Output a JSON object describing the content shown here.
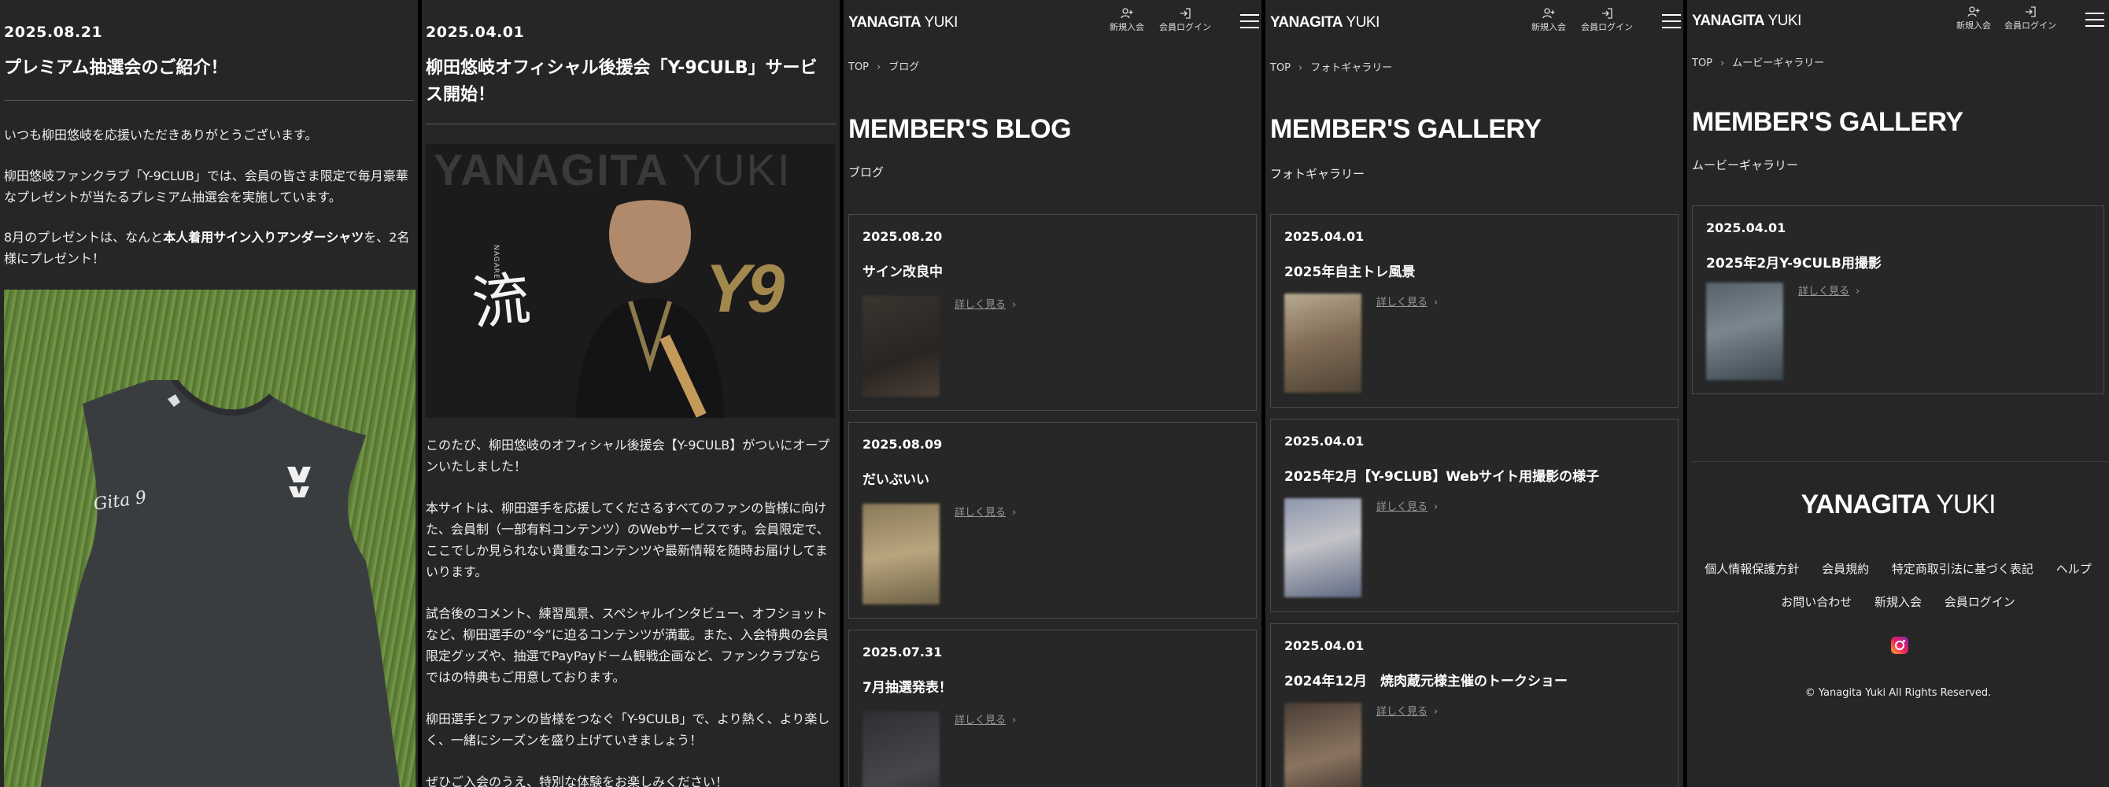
{
  "panel1": {
    "date": "2025.08.21",
    "title": "プレミアム抽選会のご紹介！",
    "p1": "いつも柳田悠岐を応援いただきありがとうございます。",
    "p2": "柳田悠岐ファンクラブ「Y-9CLUB」では、会員の皆さま限定で毎月豪華なプレゼントが当たるプレミアム抽選会を実施しています。",
    "p3_pre": "8月のプレゼントは、なんと",
    "p3_bold": "本人着用サイン入りアンダーシャツ",
    "p3_post": "を、2名様にプレゼント！",
    "photo": {
      "shirt_text": "Gita 9"
    }
  },
  "panel2": {
    "date": "2025.04.01",
    "title": "柳田悠岐オフィシャル後援会「Y-9CULB」サービス開始！",
    "hero": {
      "bg_bold": "YANAGITA",
      "bg_light": " YUKI",
      "kanji": "流",
      "small": "NAGARE",
      "emblem": "Y9"
    },
    "p1": "このたび、柳田悠岐のオフィシャル後援会【Y-9CULB】がついにオープンいたしました！",
    "p2": "本サイトは、柳田選手を応援してくださるすべてのファンの皆様に向けた、会員制（一部有料コンテンツ）のWebサービスです。会員限定で、ここでしか見られない貴重なコンテンツや最新情報を随時お届けしてまいります。",
    "p3": "試合後のコメント、練習風景、スペシャルインタビュー、オフショットなど、柳田選手の“今”に迫るコンテンツが満載。また、入会特典の会員限定グッズや、抽選でPayPayドーム観戦企画など、ファンクラブならではの特典もご用意しております。",
    "p4": "柳田選手とファンの皆様をつなぐ「Y-9CULB」で、より熱く、より楽しく、一緒にシーズンを盛り上げていきましょう！",
    "p5": "ぜひご入会のうえ、特別な体験をお楽しみください！"
  },
  "header": {
    "logo_bold": "YANAGITA",
    "logo_light": "YUKI",
    "signup": "新規入会",
    "login": "会員ログイン"
  },
  "panel3": {
    "crumb_top": "TOP",
    "crumb_current": "ブログ",
    "heading_bold": "MEMBER'S",
    "heading_light": " BLOG",
    "subheading": "ブログ",
    "cards": [
      {
        "date": "2025.08.20",
        "title": "サイン改良中",
        "link": "詳しく見る"
      },
      {
        "date": "2025.08.09",
        "title": "だいぶいい",
        "link": "詳しく見る"
      },
      {
        "date": "2025.07.31",
        "title": "7月抽選発表！",
        "link": "詳しく見る"
      }
    ]
  },
  "panel4": {
    "crumb_top": "TOP",
    "crumb_current": "フォトギャラリー",
    "heading_bold": "MEMBER'S",
    "heading_light": " GALLERY",
    "subheading": "フォトギャラリー",
    "cards": [
      {
        "date": "2025.04.01",
        "title": "2025年自主トレ風景",
        "link": "詳しく見る"
      },
      {
        "date": "2025.04.01",
        "title": "2025年2月【Y-9CLUB】Webサイト用撮影の様子",
        "link": "詳しく見る"
      },
      {
        "date": "2025.04.01",
        "title": "2024年12月　焼肉蔵元様主催のトークショー",
        "link": "詳しく見る"
      }
    ]
  },
  "panel5": {
    "crumb_top": "TOP",
    "crumb_current": "ムービーギャラリー",
    "heading_bold": "MEMBER'S",
    "heading_light": " GALLERY",
    "subheading": "ムービーギャラリー",
    "cards": [
      {
        "date": "2025.04.01",
        "title": "2025年2月Y-9CULB用撮影",
        "link": "詳しく見る"
      }
    ],
    "footer": {
      "logo_bold": "YANAGITA",
      "logo_light": "YUKI",
      "links_row1": [
        "個人情報保護方針",
        "会員規約",
        "特定商取引法に基づく表記",
        "ヘルプ"
      ],
      "links_row2": [
        "お問い合わせ",
        "新規入会",
        "会員ログイン"
      ],
      "copyright": "© Yanagita Yuki All Rights Reserved."
    }
  },
  "icons": {
    "signup": "user-plus-icon",
    "login": "login-icon",
    "menu": "hamburger-icon",
    "chevron": "chevron-right-icon",
    "instagram": "instagram-icon"
  },
  "colors": {
    "background": "#262626",
    "card_border": "#4a4a4a",
    "muted_link": "#999999",
    "accent_gold": "#a3884d"
  }
}
